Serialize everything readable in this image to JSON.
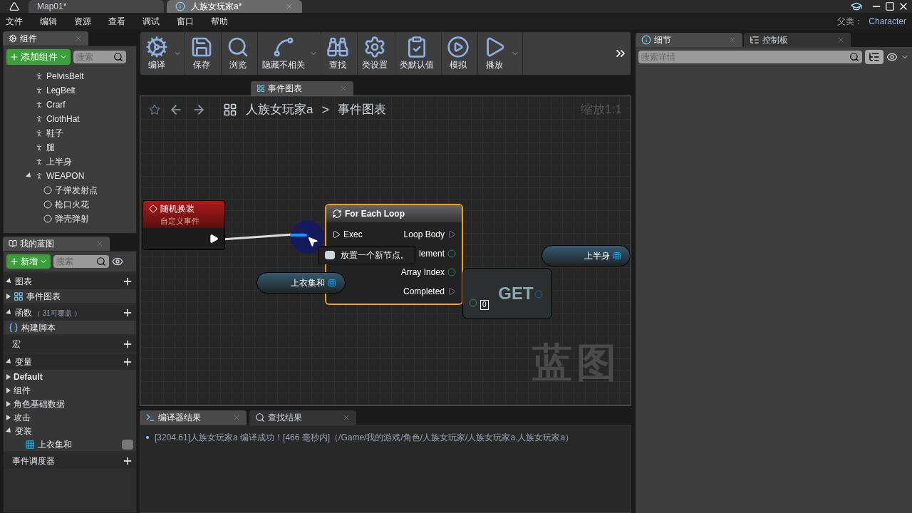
{
  "title_bar": {
    "tabs": [
      {
        "label": "Map01*",
        "selected": false
      },
      {
        "label": "人族女玩家a*",
        "selected": true
      }
    ]
  },
  "menu": {
    "items": [
      "文件",
      "编辑",
      "资源",
      "查看",
      "调试",
      "窗口",
      "帮助"
    ],
    "parent_label": "父类：",
    "parent_value": "Character"
  },
  "components_panel": {
    "tab": "组件",
    "add_button": "添加组件",
    "search_placeholder": "搜索",
    "tree": [
      {
        "label": "PelvisBelt",
        "kind": "mesh"
      },
      {
        "label": "LegBelt",
        "kind": "mesh"
      },
      {
        "label": "Crarf",
        "kind": "mesh"
      },
      {
        "label": "ClothHat",
        "kind": "mesh"
      },
      {
        "label": "鞋子",
        "kind": "mesh"
      },
      {
        "label": "腿",
        "kind": "mesh"
      },
      {
        "label": "上半身",
        "kind": "mesh"
      },
      {
        "label": "WEAPON",
        "kind": "mesh",
        "expanded": true,
        "children": [
          {
            "label": "子弹发射点",
            "kind": "point"
          },
          {
            "label": "枪口火花",
            "kind": "point"
          },
          {
            "label": "弹壳弹射",
            "kind": "point"
          }
        ]
      }
    ]
  },
  "blueprint_panel": {
    "tab": "我的蓝图",
    "new_button": "新增",
    "search_placeholder": "搜索",
    "sections": [
      {
        "label": "图表",
        "expanded": true,
        "children": [
          {
            "label": "事件图表",
            "kind": "graph",
            "expanded": false
          }
        ]
      },
      {
        "label": "函数",
        "note": "（ 31可覆盖 ）",
        "expanded": true,
        "children": [
          {
            "label": "构建脚本",
            "kind": "function"
          }
        ]
      },
      {
        "label": "宏"
      },
      {
        "label": "变量",
        "expanded": true,
        "children": [
          {
            "label": "Default",
            "kind": "category",
            "bold": true,
            "expanded": false
          },
          {
            "label": "组件",
            "kind": "category",
            "bold": false,
            "expanded": false
          },
          {
            "label": "角色基础数据",
            "kind": "category",
            "bold": false,
            "expanded": false
          },
          {
            "label": "攻击",
            "kind": "category",
            "bold": false,
            "expanded": false
          },
          {
            "label": "变装",
            "kind": "category",
            "bold": false,
            "expanded": true,
            "children": [
              {
                "label": "上衣集和",
                "kind": "variable"
              }
            ]
          }
        ]
      },
      {
        "label": "事件调度器"
      }
    ]
  },
  "toolbar": [
    {
      "label": "编译",
      "kind": "compile",
      "has_menu": true
    },
    {
      "label": "保存",
      "kind": "save",
      "has_menu": false
    },
    {
      "label": "浏览",
      "kind": "browse",
      "has_menu": false
    },
    {
      "label": "隐藏不相关",
      "kind": "hide",
      "has_menu": true
    },
    {
      "label": "查找",
      "kind": "find",
      "has_menu": false
    },
    {
      "label": "类设置",
      "kind": "settings",
      "has_menu": false
    },
    {
      "label": "类默认值",
      "kind": "defaults",
      "has_menu": false
    },
    {
      "label": "模拟",
      "kind": "simulate",
      "has_menu": false
    },
    {
      "label": "播放",
      "kind": "play",
      "has_menu": true
    }
  ],
  "graph_tab": "事件图表",
  "graph": {
    "breadcrumb": [
      "人族女玩家a",
      "事件图表"
    ],
    "breadcrumb_separator": ">",
    "zoom": "缩放1:1",
    "corner_label": "蓝图",
    "tooltip": "放置一个新节点。",
    "nodes": [
      {
        "kind": "event",
        "title": "随机换装",
        "subtitle": "自定义事件",
        "selected": false
      },
      {
        "kind": "loop",
        "title": "For Each Loop",
        "selected": true,
        "inputs": [
          {
            "label": "Exec",
            "kind": "exec"
          }
        ],
        "outputs": [
          {
            "label": "Loop Body",
            "kind": "exec"
          },
          {
            "label": "lement",
            "kind": "data"
          },
          {
            "label": "Array Index",
            "kind": "data"
          },
          {
            "label": "Completed",
            "kind": "exec"
          }
        ]
      },
      {
        "kind": "variable",
        "title": "上衣集和",
        "selected": false
      },
      {
        "kind": "variable",
        "title": "上半身",
        "selected": false
      },
      {
        "kind": "get",
        "title": "GET",
        "index": "0",
        "selected": false
      }
    ]
  },
  "results": {
    "tabs": [
      {
        "label": "编译器结果",
        "selected": true
      },
      {
        "label": "查找结果",
        "selected": false
      }
    ],
    "lines": [
      "[3204.61]人族女玩家a 编译成功！[466 毫秒内]（/Game/我的游戏/角色/人族女玩家/人族女玩家a.人族女玩家a）"
    ]
  },
  "details": {
    "tabs": [
      {
        "label": "细节",
        "selected": true
      },
      {
        "label": "控制板",
        "selected": false
      }
    ],
    "search_placeholder": "搜索详情"
  }
}
